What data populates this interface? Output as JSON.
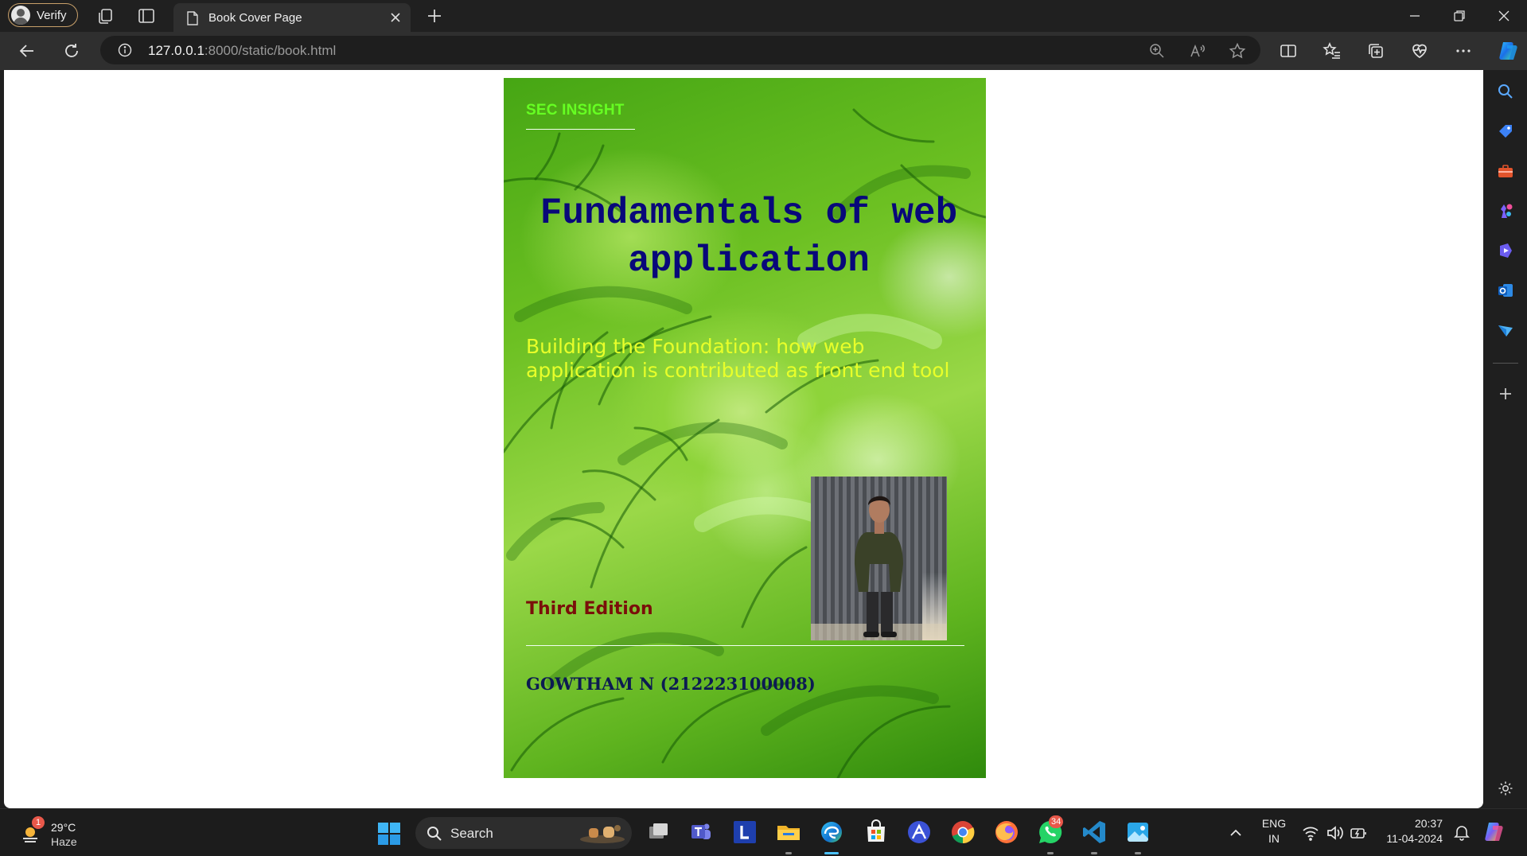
{
  "browser": {
    "profile_label": "Verify",
    "tab_title": "Book Cover Page",
    "url_host": "127.0.0.1",
    "url_path": ":8000/static/book.html"
  },
  "cover": {
    "brand": "SEC INSIGHT",
    "title": "Fundamentals of web application",
    "subtitle": "Building the Foundation: how web application is contributed as front end tool",
    "edition": "Third Edition",
    "author": "GOWTHAM N (212223100008)"
  },
  "taskbar": {
    "weather_temp": "29°C",
    "weather_condition": "Haze",
    "weather_badge": "1",
    "search_label": "Search",
    "whatsapp_badge": "34",
    "language_line1": "ENG",
    "language_line2": "IN",
    "time": "20:37",
    "date": "11-04-2024"
  },
  "colors": {
    "brand": "#66ff22",
    "title": "#08087a",
    "subtitle": "#e8ff2a",
    "edition": "#7a0f0a",
    "author": "#0c1b52",
    "accent": "#4cc2ff"
  }
}
